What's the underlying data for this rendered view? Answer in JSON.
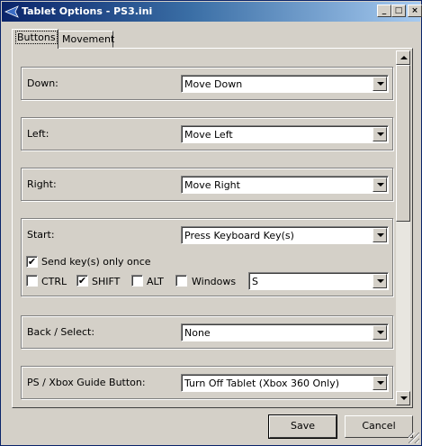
{
  "window": {
    "title": "Tablet Options - PS3.ini",
    "controls": {
      "minimize": "_",
      "maximize": "□",
      "close": "×"
    }
  },
  "tabs": [
    {
      "label": "Buttons",
      "active": true
    },
    {
      "label": "Movement",
      "active": false
    }
  ],
  "groups": {
    "down": {
      "label": "Down:",
      "value": "Move Down"
    },
    "left": {
      "label": "Left:",
      "value": "Move Left"
    },
    "right": {
      "label": "Right:",
      "value": "Move Right"
    },
    "start": {
      "label": "Start:",
      "value": "Press Keyboard Key(s)",
      "send_once": {
        "label": "Send key(s) only once",
        "checked": true
      },
      "modifiers": {
        "ctrl": {
          "label": "CTRL",
          "checked": false
        },
        "shift": {
          "label": "SHIFT",
          "checked": true
        },
        "alt": {
          "label": "ALT",
          "checked": false
        },
        "windows": {
          "label": "Windows",
          "checked": false
        }
      },
      "key": "S"
    },
    "back": {
      "label": "Back / Select:",
      "value": "None"
    },
    "guide": {
      "label": "PS / Xbox Guide Button:",
      "value": "Turn Off Tablet (Xbox 360 Only)"
    }
  },
  "check_mark": "✔",
  "buttons": {
    "save": "Save",
    "cancel": "Cancel"
  },
  "colors": {
    "titlebar_start": "#0a246a",
    "titlebar_end": "#a6caf0",
    "face": "#d4d0c8"
  }
}
